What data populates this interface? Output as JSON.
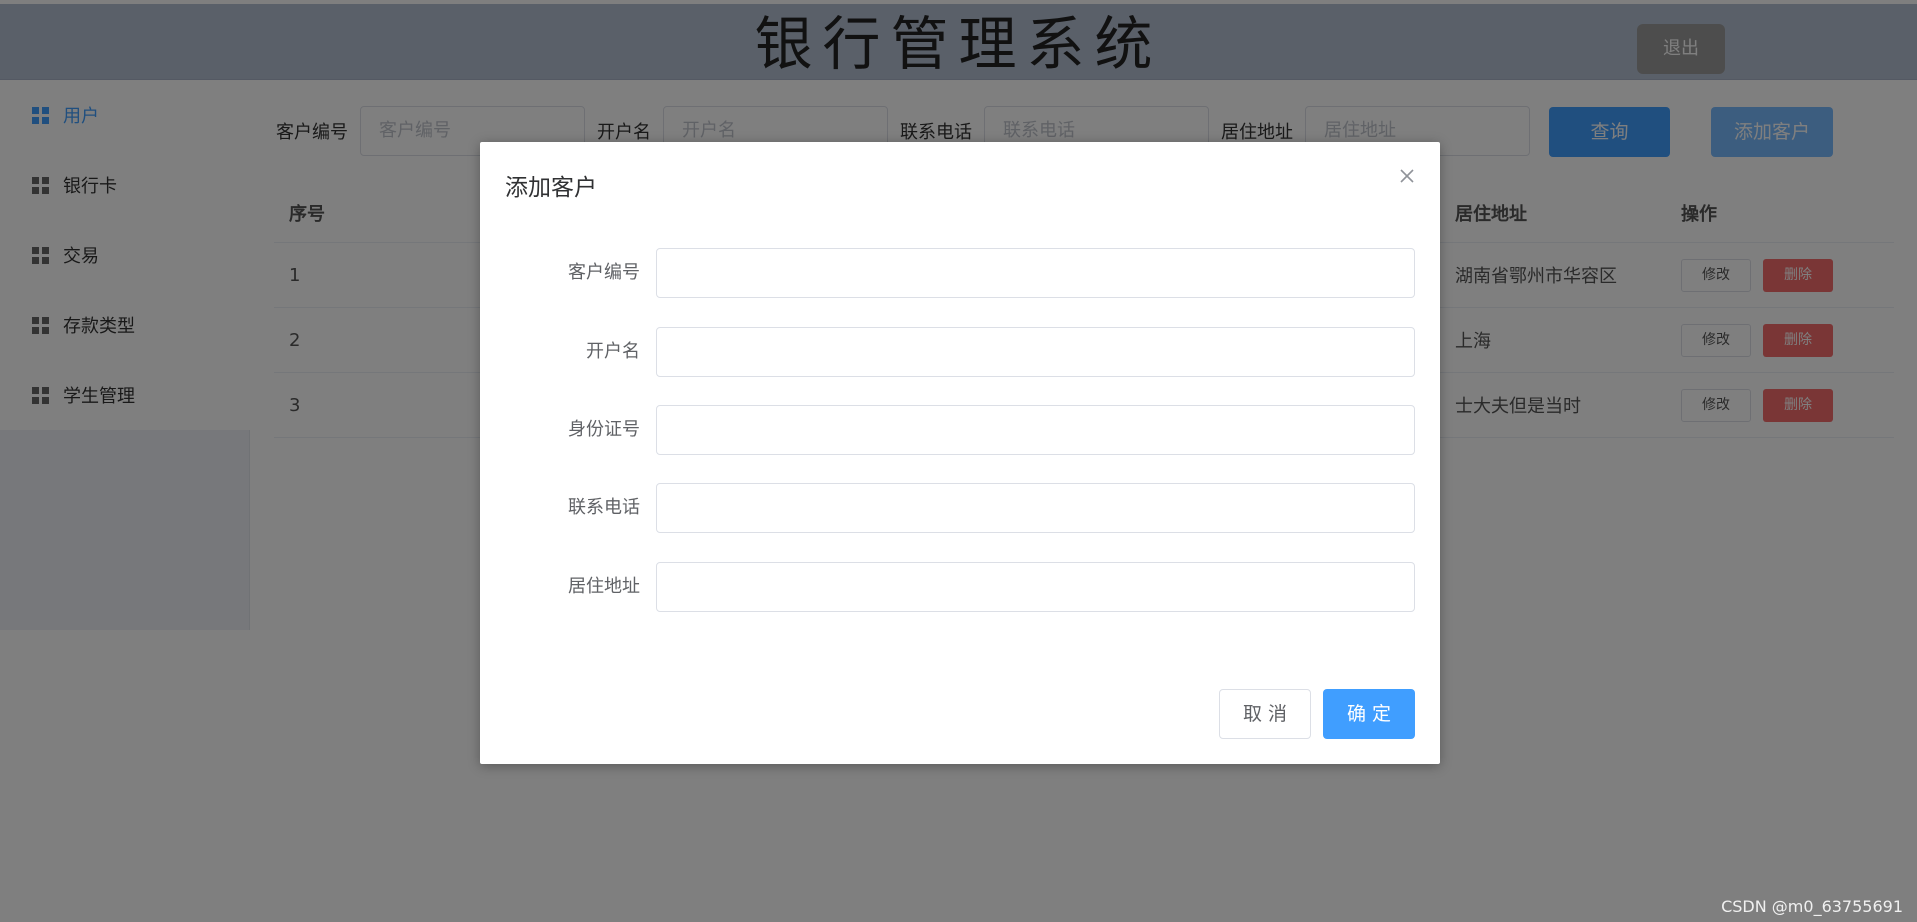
{
  "header": {
    "title": "银行管理系统",
    "logout_label": "退出"
  },
  "sidebar": {
    "items": [
      {
        "label": "用户",
        "icon": "grid-icon",
        "active": true
      },
      {
        "label": "银行卡",
        "icon": "grid-icon"
      },
      {
        "label": "交易",
        "icon": "grid-icon"
      },
      {
        "label": "存款类型",
        "icon": "grid-icon"
      },
      {
        "label": "学生管理",
        "icon": "grid-icon"
      }
    ]
  },
  "search": {
    "fields": [
      {
        "label": "客户编号",
        "placeholder": "客户编号"
      },
      {
        "label": "开户名",
        "placeholder": "开户名"
      },
      {
        "label": "联系电话",
        "placeholder": "联系电话"
      },
      {
        "label": "居住地址",
        "placeholder": "居住地址"
      }
    ],
    "query_label": "查询",
    "add_label": "添加客户"
  },
  "table": {
    "headers": {
      "seq": "序号",
      "address": "居住地址",
      "ops": "操作"
    },
    "rows": [
      {
        "seq": "1",
        "address": "湖南省鄂州市华容区"
      },
      {
        "seq": "2",
        "address": "上海"
      },
      {
        "seq": "3",
        "address": "士大夫但是当时"
      }
    ],
    "edit_label": "修改",
    "delete_label": "删除"
  },
  "dialog": {
    "title": "添加客户",
    "fields": [
      {
        "label": "客户编号",
        "value": ""
      },
      {
        "label": "开户名",
        "value": ""
      },
      {
        "label": "身份证号",
        "value": ""
      },
      {
        "label": "联系电话",
        "value": ""
      },
      {
        "label": "居住地址",
        "value": ""
      }
    ],
    "cancel_label": "取 消",
    "confirm_label": "确 定"
  },
  "watermark": "CSDN @m0_63755691",
  "colors": {
    "primary": "#409eff",
    "danger": "#f56c6c",
    "overlay": "rgba(0,0,0,0.5)"
  }
}
